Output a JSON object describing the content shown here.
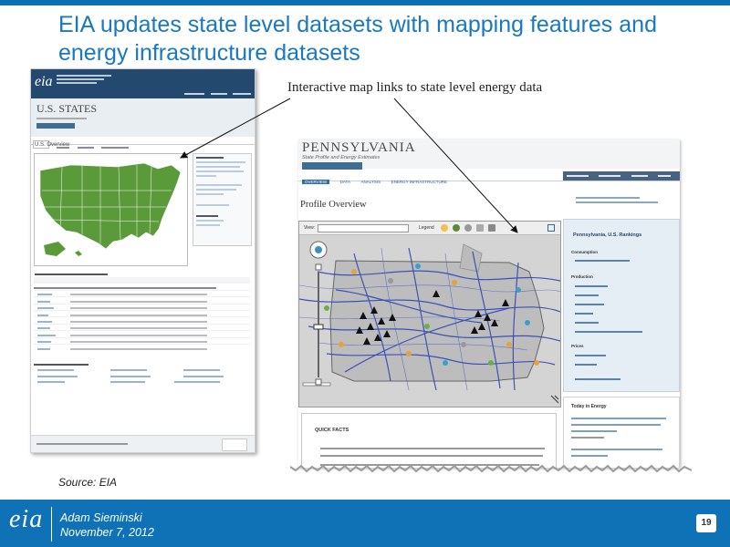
{
  "slide": {
    "title": "EIA updates state level datasets with mapping features and energy infrastructure datasets",
    "callout": "Interactive map links to state level energy data",
    "source": "Source: EIA",
    "presenter": "Adam Sieminski",
    "date": "November 7, 2012",
    "page_number": "19",
    "logo_text": "eia"
  },
  "us_page": {
    "logo": "eia",
    "title": "U.S. STATES",
    "section": "U.S. Overview"
  },
  "pa_page": {
    "state": "PENNSYLVANIA",
    "subtitle": "State Profile and Energy Estimates",
    "tabs": [
      "OVERVIEW",
      "DATA",
      "ANALYSIS",
      "ENERGY INFRASTRUCTURE"
    ],
    "profile_heading": "Profile Overview",
    "map_view_label": "View:",
    "legend_label": "Legend",
    "rankings_title": "Pennsylvania, U.S. Rankings",
    "rankings": [
      {
        "heading": "Consumption",
        "rows": [
          "",
          ""
        ]
      },
      {
        "heading": "Production",
        "rows": [
          "",
          "",
          "",
          "",
          "",
          ""
        ]
      },
      {
        "heading": "Prices",
        "rows": [
          "",
          ""
        ]
      }
    ],
    "today_title": "Today in Energy",
    "quick_facts_title": "QUICK FACTS"
  },
  "colors": {
    "accent": "#1878c4",
    "footer": "#0f71b6",
    "map_green": "#5a9a3a",
    "header_navy": "#23496f"
  }
}
